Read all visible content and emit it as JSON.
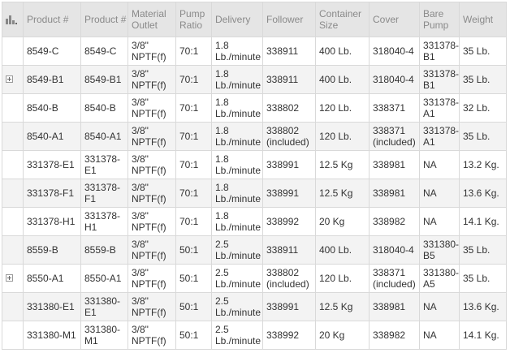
{
  "columns": [
    "Product #",
    "Product #",
    "Material Outlet",
    "Pump Ratio",
    "Delivery",
    "Follower",
    "Container Size",
    "Cover",
    "Bare Pump",
    "Weight"
  ],
  "rows": [
    {
      "expandable": false,
      "cells": [
        "8549-C",
        "8549-C",
        "3/8\" NPTF(f)",
        "70:1",
        "1.8 Lb./minute",
        "338911",
        "400 Lb.",
        "318040-4",
        "331378-B1",
        "35 Lb."
      ]
    },
    {
      "expandable": true,
      "cells": [
        "8549-B1",
        "8549-B1",
        "3/8\" NPTF(f)",
        "70:1",
        "1.8 Lb./minute",
        "338911",
        "400 Lb.",
        "318040-4",
        "331378-B1",
        "35 Lb."
      ]
    },
    {
      "expandable": false,
      "cells": [
        "8540-B",
        "8540-B",
        "3/8\" NPTF(f)",
        "70:1",
        "1.8 Lb./minute",
        "338802",
        "120 Lb.",
        "338371",
        "331378-A1",
        "32 Lb."
      ]
    },
    {
      "expandable": false,
      "cells": [
        "8540-A1",
        "8540-A1",
        "3/8\" NPTF(f)",
        "70:1",
        "1.8 Lb./minute",
        "338802 (included)",
        "120 Lb.",
        "338371 (included)",
        "331378-A1",
        "35 Lb."
      ]
    },
    {
      "expandable": false,
      "cells": [
        "331378-E1",
        "331378-E1",
        "3/8\" NPTF(f)",
        "70:1",
        "1.8 Lb./minute",
        "338991",
        "12.5 Kg",
        "338981",
        "NA",
        "13.2 Kg."
      ]
    },
    {
      "expandable": false,
      "cells": [
        "331378-F1",
        "331378-F1",
        "3/8\" NPTF(f)",
        "70:1",
        "1.8 Lb./minute",
        "338991",
        "12.5 Kg",
        "338981",
        "NA",
        "13.6 Kg."
      ]
    },
    {
      "expandable": false,
      "cells": [
        "331378-H1",
        "331378-H1",
        "3/8\" NPTF(f)",
        "70:1",
        "1.8 Lb./minute",
        "338992",
        "20 Kg",
        "338982",
        "NA",
        "14.1 Kg."
      ]
    },
    {
      "expandable": false,
      "cells": [
        "8559-B",
        "8559-B",
        "3/8\" NPTF(f)",
        "50:1",
        "2.5 Lb./minute",
        "338911",
        "400 Lb.",
        "318040-4",
        "331380-B5",
        "35 Lb."
      ]
    },
    {
      "expandable": true,
      "cells": [
        "8550-A1",
        "8550-A1",
        "3/8\" NPTF(f)",
        "50:1",
        "2.5 Lb./minute",
        "338802 (included)",
        "120 Lb.",
        "338371 (included)",
        "331380-A5",
        "35 Lb."
      ]
    },
    {
      "expandable": false,
      "cells": [
        "331380-E1",
        "331380-E1",
        "3/8\" NPTF(f)",
        "50:1",
        "2.5 Lb./minute",
        "338991",
        "12.5 Kg",
        "338981",
        "NA",
        "13.6 Kg."
      ]
    },
    {
      "expandable": false,
      "cells": [
        "331380-M1",
        "331380-M1",
        "3/8\" NPTF(f)",
        "50:1",
        "2.5 Lb./minute",
        "338992",
        "20 Kg",
        "338982",
        "NA",
        "14.1 Kg."
      ]
    }
  ],
  "icons": {
    "column_chooser": "column-chooser-icon",
    "expand": "expand-plus-icon"
  },
  "colors": {
    "header_bg": "#e5e5e5",
    "header_text": "#8a8a8a",
    "stripe_bg": "#f3f3f3",
    "border": "#d9d9d9"
  }
}
